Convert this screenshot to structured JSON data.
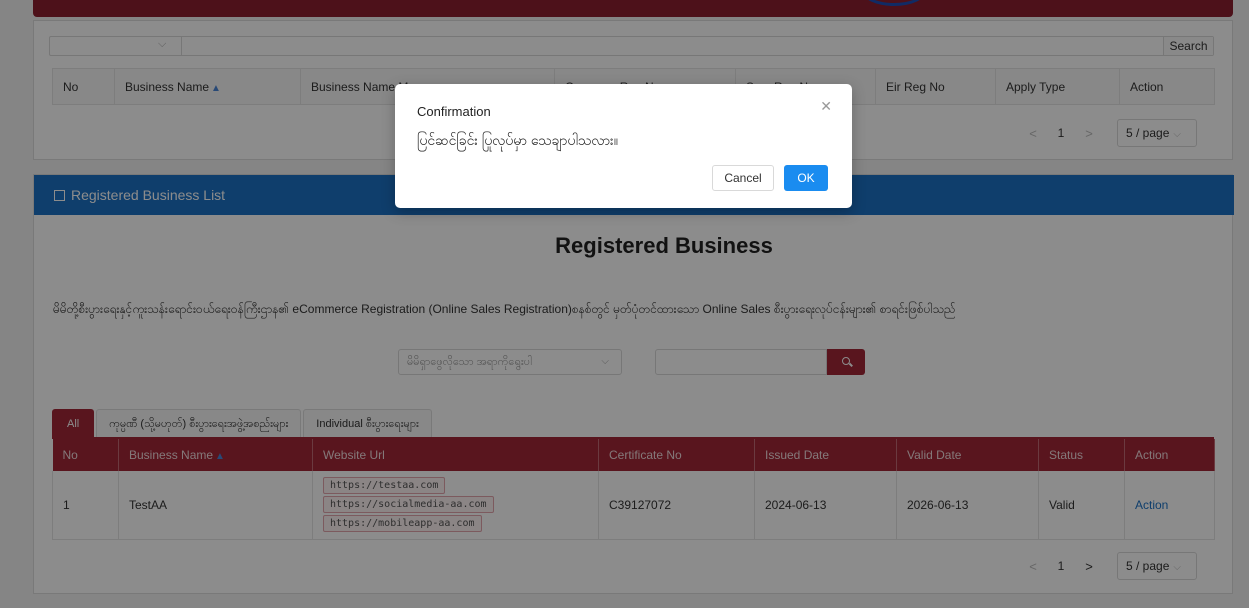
{
  "upper": {
    "search_label": "Search",
    "columns": [
      "No",
      "Business Name",
      "Business Name Myanmar",
      "Company Reg No",
      "Sme Reg No",
      "Eir Reg No",
      "Apply Type",
      "Action"
    ],
    "pager": {
      "page": "1",
      "page_size": "5 / page"
    }
  },
  "lower": {
    "header": "Registered Business List",
    "title": "Registered Business",
    "description": "မိမိတို့စီးပွားရေးနှင့်ကူးသန်းရောင်းဝယ်ရေးဝန်ကြီးဌာန၏ eCommerce Registration (Online Sales Registration)စနစ်တွင် မှတ်ပုံတင်ထားသော Online Sales စီးပွားရေးလုပ်ငန်းများ၏ စာရင်းဖြစ်ပါသည်",
    "type_select_placeholder": "မိမိရှာဖွေလိုသော အရာကိုရွေးပါ",
    "tabs": [
      "All",
      "ကုမ္ပဏီ (သို့မဟုတ်) စီးပွားရေးအဖွဲ့အစည်းများ",
      "Individual စီးပွားရေးများ"
    ],
    "columns": [
      "No",
      "Business Name",
      "Website Url",
      "Certificate No",
      "Issued Date",
      "Valid Date",
      "Status",
      "Action"
    ],
    "rows": [
      {
        "no": "1",
        "name": "TestAA",
        "urls": [
          "https://testaa.com",
          "https://socialmedia-aa.com",
          "https://mobileapp-aa.com"
        ],
        "certificate": "C39127072",
        "issued": "2024-06-13",
        "valid": "2026-06-13",
        "status": "Valid",
        "action": "Action"
      }
    ],
    "pager": {
      "page": "1",
      "page_size": "5 / page"
    }
  },
  "modal": {
    "title": "Confirmation",
    "message": "ပြင်ဆင်ခြင်း ပြုလုပ်မှာ သေချာပါသလား။",
    "cancel": "Cancel",
    "ok": "OK"
  },
  "icons": {
    "close": "close-icon",
    "search": "search-icon",
    "list": "list-icon",
    "sort": "sort-up-icon",
    "chevron": "chevron-down-icon"
  },
  "colors": {
    "primary_red": "#a32737",
    "header_blue": "#1c72c5",
    "ok_blue": "#1a8cf0"
  }
}
